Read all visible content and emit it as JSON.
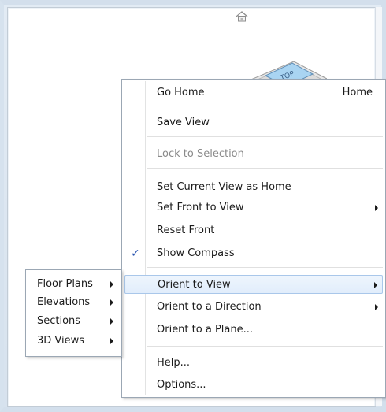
{
  "viewcube": {
    "face_label": "TOP"
  },
  "menu": {
    "items": [
      {
        "label": "Go Home",
        "shortcut": "Home"
      },
      {
        "label": "Save View"
      },
      {
        "label": "Lock to Selection"
      },
      {
        "label": "Set Current View as Home"
      },
      {
        "label": "Set Front to View"
      },
      {
        "label": "Reset Front"
      },
      {
        "label": "Show Compass",
        "check": "✓"
      },
      {
        "label": "Orient to View"
      },
      {
        "label": "Orient to a Direction"
      },
      {
        "label": "Orient to a Plane..."
      },
      {
        "label": "Help..."
      },
      {
        "label": "Options..."
      }
    ]
  },
  "submenu": {
    "items": [
      {
        "label": "Floor Plans"
      },
      {
        "label": "Elevations"
      },
      {
        "label": "Sections"
      },
      {
        "label": "3D Views"
      }
    ]
  },
  "colors": {
    "highlight": "#e1edfb",
    "highlight_border": "#a9c7ea",
    "check": "#2a55b0",
    "disabled_text": "#8a8a8a"
  }
}
